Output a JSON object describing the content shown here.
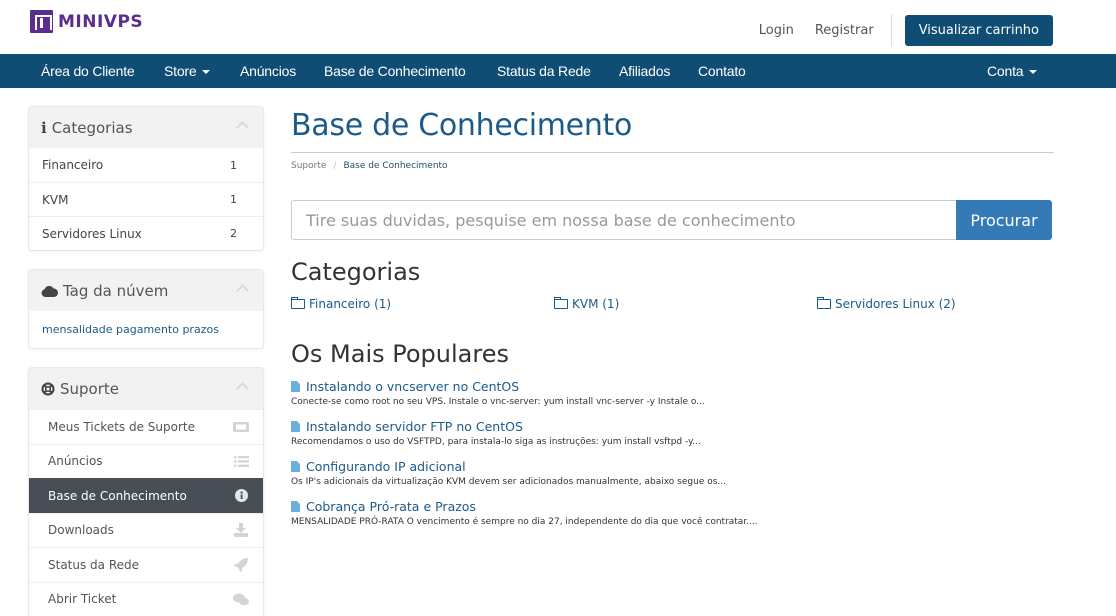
{
  "brand": {
    "name": "MINIVPS",
    "color": "#5b2e8e"
  },
  "header": {
    "login": "Login",
    "register": "Registrar",
    "cart": "Visualizar carrinho"
  },
  "nav": {
    "items": [
      {
        "label": "Área do Cliente"
      },
      {
        "label": "Store",
        "dropdown": true
      },
      {
        "label": "Anúncios"
      },
      {
        "label": "Base de Conhecimento"
      },
      {
        "label": "Status da Rede"
      },
      {
        "label": "Afiliados"
      },
      {
        "label": "Contato"
      }
    ],
    "account": "Conta",
    "bg_color": "#0f4d75"
  },
  "sidebar": {
    "categories": {
      "title": "Categorias",
      "icon": "info-icon",
      "items": [
        {
          "label": "Financeiro",
          "count": "1"
        },
        {
          "label": "KVM",
          "count": "1"
        },
        {
          "label": "Servidores Linux",
          "count": "2"
        }
      ]
    },
    "tags": {
      "title": "Tag da núvem",
      "icon": "cloud-icon",
      "text": "mensalidade pagamento prazos"
    },
    "support": {
      "title": "Suporte",
      "icon": "life-ring-icon",
      "items": [
        {
          "label": "Meus Tickets de Suporte",
          "icon": "ticket-icon"
        },
        {
          "label": "Anúncios",
          "icon": "list-icon"
        },
        {
          "label": "Base de Conhecimento",
          "icon": "info-circle-icon",
          "active": true
        },
        {
          "label": "Downloads",
          "icon": "download-icon"
        },
        {
          "label": "Status da Rede",
          "icon": "rocket-icon"
        },
        {
          "label": "Abrir Ticket",
          "icon": "comments-icon"
        }
      ]
    }
  },
  "main": {
    "title": "Base de Conhecimento",
    "breadcrumb": [
      "Suporte",
      "Base de Conhecimento"
    ],
    "search": {
      "placeholder": "Tire suas duvidas, pesquise em nossa base de conhecimento",
      "value": "",
      "button": "Procurar"
    },
    "categories_heading": "Categorias",
    "categories": [
      "Financeiro (1)",
      "KVM (1)",
      "Servidores Linux (2)"
    ],
    "popular_heading": "Os Mais Populares",
    "articles": [
      {
        "title": "Instalando o vncserver no CentOS",
        "excerpt": "Conecte-se como root no seu VPS. Instale o vnc-server: yum install vnc-server -y Instale o..."
      },
      {
        "title": "Instalando servidor FTP no CentOS",
        "excerpt": "Recomendamos o uso do VSFTPD, para instala-lo siga as instruções:   yum install vsftpd -y..."
      },
      {
        "title": "Configurando IP adicional",
        "excerpt": "Os IP's adicionais da virtualização KVM devem ser adicionados manualmente, abaixo segue os..."
      },
      {
        "title": "Cobrança Pró-rata e Prazos",
        "excerpt": "MENSALIDADE PRÓ-RATA O vencimento é sempre no dia 27, independente do dia que você contratar...."
      }
    ]
  }
}
